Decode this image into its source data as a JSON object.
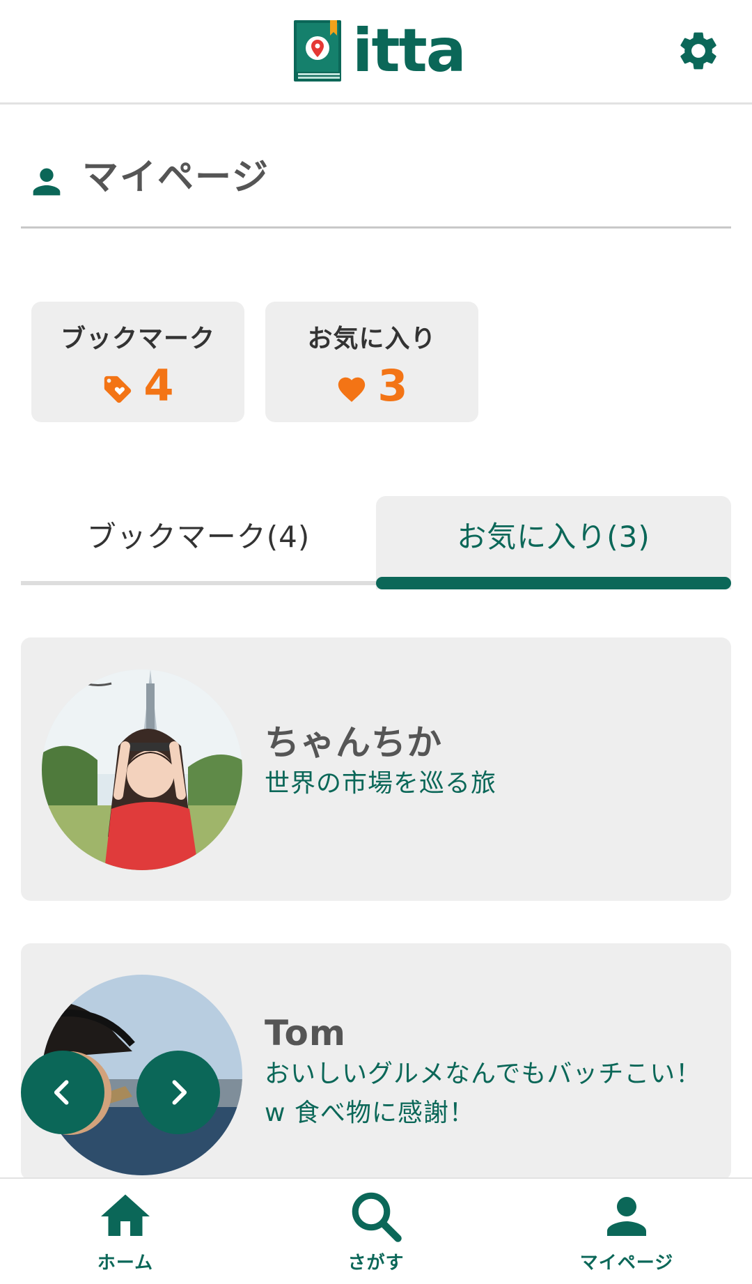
{
  "header": {
    "logo_text": "itta",
    "settings_icon": "gear-icon"
  },
  "page": {
    "title": "マイページ",
    "title_icon": "person-icon"
  },
  "stats": [
    {
      "label": "ブックマーク",
      "value": "4",
      "icon": "tag-icon"
    },
    {
      "label": "お気に入り",
      "value": "3",
      "icon": "heart-icon"
    }
  ],
  "tabs": [
    {
      "label": "ブックマーク(4)",
      "active": false
    },
    {
      "label": "お気に入り(3)",
      "active": true
    }
  ],
  "users": [
    {
      "name": "ちゃんちか",
      "description": "世界の市場を巡る旅"
    },
    {
      "name": "Tom",
      "description": "おいしいグルメなんでもバッチこい！w 食べ物に感謝！"
    }
  ],
  "carousel": {
    "prev_icon": "chevron-left-icon",
    "next_icon": "chevron-right-icon"
  },
  "bottom_nav": [
    {
      "label": "ホーム",
      "icon": "home-icon"
    },
    {
      "label": "さがす",
      "icon": "search-icon"
    },
    {
      "label": "マイページ",
      "icon": "person-icon",
      "active": true
    }
  ],
  "colors": {
    "brand": "#0b6758",
    "accent": "#f37415",
    "card_bg": "#eeeeee"
  }
}
